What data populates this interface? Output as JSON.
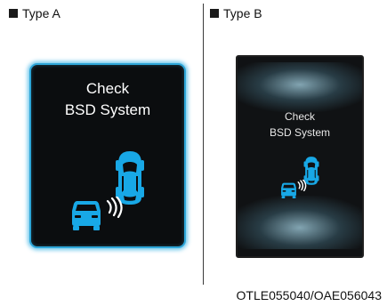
{
  "figure": {
    "type_a": {
      "label": "Type A",
      "message_line_1": "Check",
      "message_line_2": "BSD System"
    },
    "type_b": {
      "label": "Type B",
      "message_line_1": "Check",
      "message_line_2": "BSD System"
    },
    "reference_code": "OTLE055040/OAE056043"
  },
  "colors": {
    "display_background": "#0b0d0f",
    "display_border_type_a": "#2ea6d8",
    "vehicle_icon": "#18a8e6",
    "warning_waves": "#ffffff"
  },
  "icons": {
    "host_vehicle": "car-top-view-icon",
    "approaching_vehicle": "car-front-view-icon",
    "warning": "signal-waves-icon"
  }
}
